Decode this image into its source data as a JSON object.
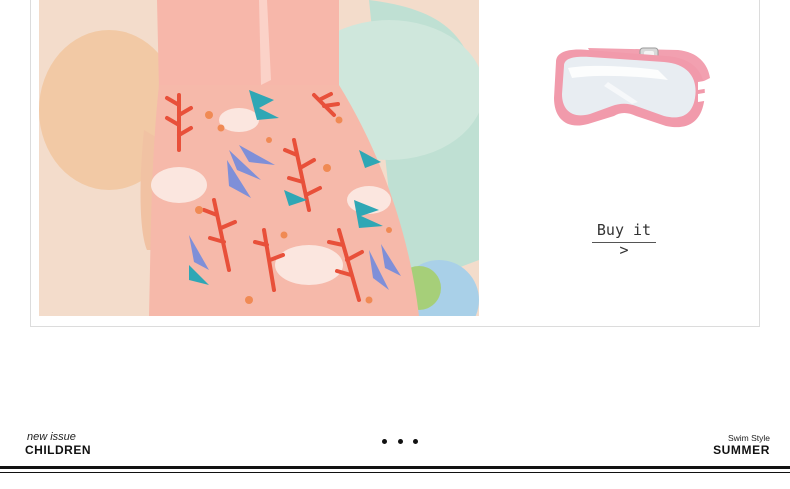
{
  "product": {
    "buy_label": "Buy it >",
    "photo_icon": "girl-in-floral-swim-dress",
    "goggles_icon": "pink-swim-goggles"
  },
  "footer": {
    "left_small": "new issue",
    "left_big": "CHILDREN",
    "right_small": "Swim Style",
    "right_big": "SUMMER",
    "more_icon": "more-dots-icon"
  },
  "colors": {
    "dress_base": "#f6b9aa",
    "leaf_red": "#e8503a",
    "leaf_blue": "#7f8fd8",
    "leaf_teal": "#2fa7b5",
    "goggles_pink": "#f2a0b0",
    "rule": "#111111"
  }
}
